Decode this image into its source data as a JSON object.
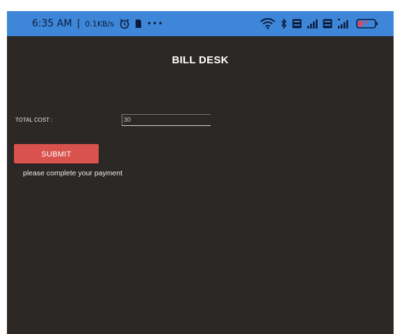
{
  "status_bar": {
    "time": "6:35 AM",
    "separator": "|",
    "data_speed": "0.1KB/s",
    "more_indicator": "•••",
    "battery_level": "14",
    "icons": [
      "alarm-icon",
      "sim-icon",
      "wifi-icon",
      "bluetooth-icon",
      "volte-icon",
      "signal-icon",
      "volte-icon",
      "signal-icon",
      "battery-icon"
    ],
    "bar_color": "#3d86d8"
  },
  "header": {
    "title": "BILL DESK"
  },
  "form": {
    "total_cost_label": "TOTAL COST :",
    "total_cost_value": "30",
    "submit_label": "SUBMIT",
    "submit_color": "#d9524d",
    "message": "please complete your payment"
  },
  "theme": {
    "background": "#2c2826",
    "text": "#ffffff"
  }
}
